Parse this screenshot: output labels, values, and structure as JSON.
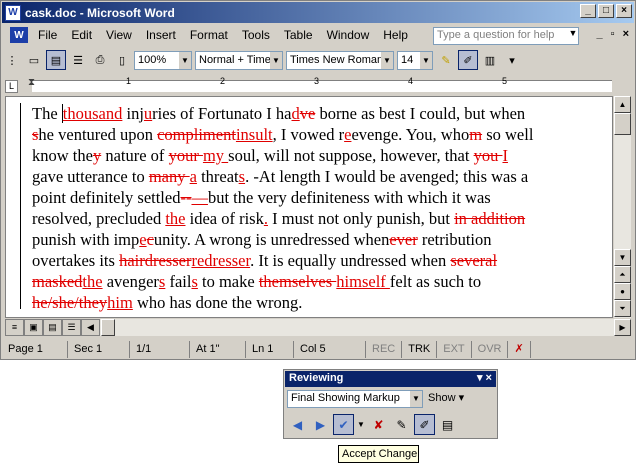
{
  "window": {
    "title": "cask.doc - Microsoft Word",
    "app_icon": "W"
  },
  "menu": {
    "items": [
      "File",
      "Edit",
      "View",
      "Insert",
      "Format",
      "Tools",
      "Table",
      "Window",
      "Help"
    ],
    "question_placeholder": "Type a question for help"
  },
  "toolbar": {
    "zoom": "100%",
    "style": "Normal + Times",
    "font": "Times New Roman",
    "size": "14"
  },
  "document": {
    "lines": [
      [
        [
          "n",
          "The "
        ],
        [
          "c",
          ""
        ],
        [
          "i",
          "thousand"
        ],
        [
          "n",
          " inj"
        ],
        [
          "i",
          "u"
        ],
        [
          "n",
          "ries of Fortunato I ha"
        ],
        [
          "i",
          "d"
        ],
        [
          "d",
          "ve"
        ],
        [
          "n",
          " borne as best I could, but when"
        ]
      ],
      [
        [
          "d",
          "s"
        ],
        [
          "n",
          "he ventured upon "
        ],
        [
          "d",
          "compliment"
        ],
        [
          "i",
          "insult"
        ],
        [
          "n",
          ", I vowed r"
        ],
        [
          "i",
          "e"
        ],
        [
          "n",
          "evenge. You, who"
        ],
        [
          "d",
          "m"
        ],
        [
          "n",
          " so well"
        ]
      ],
      [
        [
          "n",
          "know the"
        ],
        [
          "d",
          "y"
        ],
        [
          "n",
          " nature of "
        ],
        [
          "d",
          "your "
        ],
        [
          "i",
          "my "
        ],
        [
          "n",
          "soul, will not suppose, however, that "
        ],
        [
          "d",
          "you "
        ],
        [
          "i",
          "I"
        ]
      ],
      [
        [
          "n",
          "gave utterance to "
        ],
        [
          "d",
          "many "
        ],
        [
          "i",
          "a"
        ],
        [
          "n",
          " threat"
        ],
        [
          "i",
          "s"
        ],
        [
          "n",
          ". -At length I would be avenged; this was a"
        ]
      ],
      [
        [
          "n",
          "point definitely settled"
        ],
        [
          "d",
          "--"
        ],
        [
          "i",
          "—"
        ],
        [
          "n",
          "but the very definiteness with which it was"
        ]
      ],
      [
        [
          "n",
          "resolved, precluded "
        ],
        [
          "i",
          "the"
        ],
        [
          "n",
          " idea of risk"
        ],
        [
          "i",
          "."
        ],
        [
          "n",
          " I must not only punish, but "
        ],
        [
          "d",
          "in addition"
        ]
      ],
      [
        [
          "n",
          "punish with imp"
        ],
        [
          "i",
          "e"
        ],
        [
          "d",
          "c"
        ],
        [
          "n",
          "unity. A wrong is unredressed when"
        ],
        [
          "d",
          "ever"
        ],
        [
          "n",
          " retribution"
        ]
      ],
      [
        [
          "n",
          "overtakes its "
        ],
        [
          "d",
          "hairdresser"
        ],
        [
          "i",
          "redresser"
        ],
        [
          "n",
          ". It is equally undressed when "
        ],
        [
          "d",
          "several"
        ]
      ],
      [
        [
          "d",
          "masked"
        ],
        [
          "i",
          "the"
        ],
        [
          "n",
          " avenger"
        ],
        [
          "i",
          "s"
        ],
        [
          "n",
          " fail"
        ],
        [
          "i",
          "s"
        ],
        [
          "n",
          " to make "
        ],
        [
          "d",
          "themselves "
        ],
        [
          "i",
          "himself "
        ],
        [
          "n",
          "felt as such to"
        ]
      ],
      [
        [
          "d",
          "he/she/they"
        ],
        [
          "i",
          "him"
        ],
        [
          "n",
          " who has done the wrong."
        ]
      ]
    ]
  },
  "status": {
    "page": "Page  1",
    "sec": "Sec  1",
    "pages": "1/1",
    "at": "At  1\"",
    "ln": "Ln  1",
    "col": "Col  5",
    "rec": "REC",
    "trk": "TRK",
    "ext": "EXT",
    "ovr": "OVR"
  },
  "reviewing": {
    "title": "Reviewing",
    "display": "Final Showing Markup",
    "show": "Show"
  },
  "tooltip": "Accept Change",
  "ruler": {
    "numbers": [
      "1",
      "2",
      "3",
      "4",
      "5"
    ]
  },
  "colors": {
    "markup": "#e00000",
    "title_gradient_start": "#0a246a",
    "title_gradient_end": "#a6caf0"
  }
}
